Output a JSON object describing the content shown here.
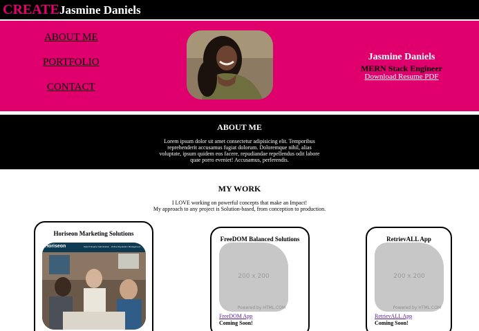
{
  "header": {
    "brand": "CREATE",
    "name": "Jasmine Daniels"
  },
  "nav": {
    "about": "ABOUT ME",
    "portfolio": "PORTFOLIO",
    "contact": "CONTACT"
  },
  "hero": {
    "name": "Jasmine Daniels",
    "role": "MERN Stack Engineer",
    "resume_link": "Download Resume PDF"
  },
  "about": {
    "title": "ABOUT ME",
    "body": "Lorem ipsum dolor sit amet consectetur adipisicing elit. Temporibus reprehenderit accusamus fugiat dolorum. Doloremque nihil, alias voluptate, ipsum quidem eos facere, repudiandae repellendus odit labore quae porro eveniet! Accusamus, perferendis."
  },
  "work": {
    "title": "MY WORK",
    "subtitle_line1": "I LOVE working on powerful concepts that make an Impact!",
    "subtitle_line2": "My approach to any project is Solution-based, from conception to production.",
    "projects": [
      {
        "title": "Horiseon Marketing Solutions",
        "screenshot_brand": "Horiseon",
        "screenshot_nav": "Search Engine Optimization · Online Reputation Management · Social Media Marketing"
      },
      {
        "title": "FreeDOM Balanced Solutions",
        "placeholder": "200 x 200",
        "placeholder_credit": "Powered by HTML.COM",
        "link": "FreeDOM App",
        "status": "Coming Soon!"
      },
      {
        "title": "RetrievALL App",
        "placeholder": "200 x 200",
        "placeholder_credit": "Powered by HTML.COM",
        "link": "RetrievALL App",
        "status": "Coming Soon!"
      }
    ]
  },
  "colors": {
    "accent": "#e0006d",
    "header_bg": "#000000",
    "link": "#551a8b"
  }
}
